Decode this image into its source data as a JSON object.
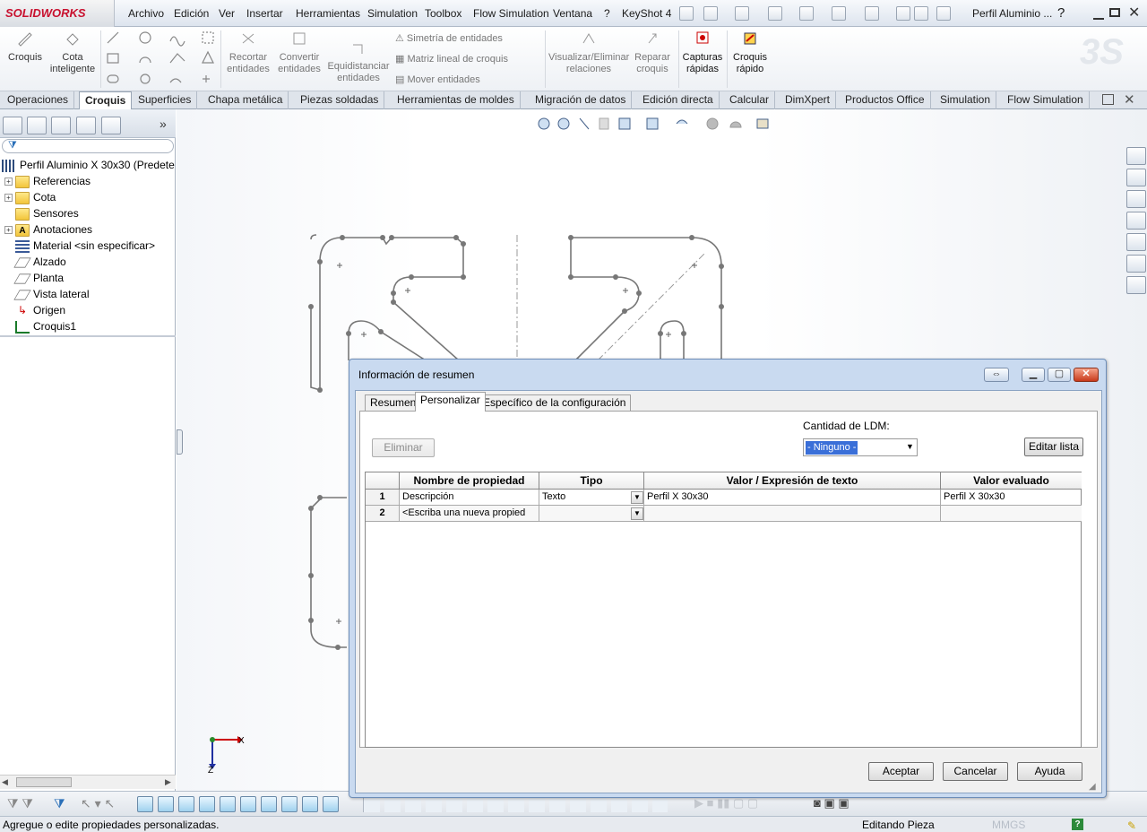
{
  "app": {
    "logo": "SOLIDWORKS",
    "window_title": "Perfil Aluminio ..."
  },
  "menu": [
    "Archivo",
    "Edición",
    "Ver",
    "Insertar",
    "Herramientas",
    "Simulation",
    "Toolbox",
    "Flow Simulation",
    "Ventana",
    "?",
    "KeyShot 4"
  ],
  "commands": {
    "croquis": "Croquis",
    "cota": "Cota inteligente",
    "recortar": "Recortar entidades",
    "convertir": "Convertir entidades",
    "equidistanciar": "Equidistanciar entidades",
    "simetria": "Simetría de entidades",
    "matriz": "Matriz lineal de croquis",
    "mover": "Mover entidades",
    "visualizar": "Visualizar/Eliminar relaciones",
    "reparar": "Reparar croquis",
    "capturas": "Capturas rápidas",
    "croquis_rapido": "Croquis rápido"
  },
  "tabs": [
    "Operaciones",
    "Croquis",
    "Superficies",
    "Chapa metálica",
    "Piezas soldadas",
    "Herramientas de moldes",
    "Migración de datos",
    "Edición directa",
    "Calcular",
    "DimXpert",
    "Productos Office",
    "Simulation",
    "Flow Simulation"
  ],
  "active_tab": "Croquis",
  "tree": {
    "root": "Perfil Aluminio X 30x30  (Predete",
    "items": [
      "Referencias",
      "Cota",
      "Sensores",
      "Anotaciones",
      "Material <sin especificar>",
      "Alzado",
      "Planta",
      "Vista lateral",
      "Origen",
      "Croquis1"
    ]
  },
  "axes": {
    "x": "X",
    "z": "Z"
  },
  "dialog": {
    "title": "Información de resumen",
    "tabs": [
      "Resumen",
      "Personalizar",
      "Específico de la configuración"
    ],
    "active_tab": "Personalizar",
    "delete_button": "Eliminar",
    "bom_label": "Cantidad de LDM:",
    "bom_value": "- Ninguno -",
    "edit_list_button": "Editar lista",
    "columns": [
      "Nombre de propiedad",
      "Tipo",
      "Valor / Expresión de texto",
      "Valor evaluado"
    ],
    "rows": [
      {
        "num": "1",
        "name": "Descripción",
        "type": "Texto",
        "value": "Perfil X 30x30",
        "evaluated": "Perfil X 30x30"
      },
      {
        "num": "2",
        "name": "<Escriba una nueva propied",
        "type": "",
        "value": "",
        "evaluated": ""
      }
    ],
    "ok_button": "Aceptar",
    "cancel_button": "Cancelar",
    "help_button": "Ayuda"
  },
  "status": {
    "message": "Agregue o edite propiedades personalizadas.",
    "mode": "Editando Pieza",
    "units": "MMGS"
  }
}
